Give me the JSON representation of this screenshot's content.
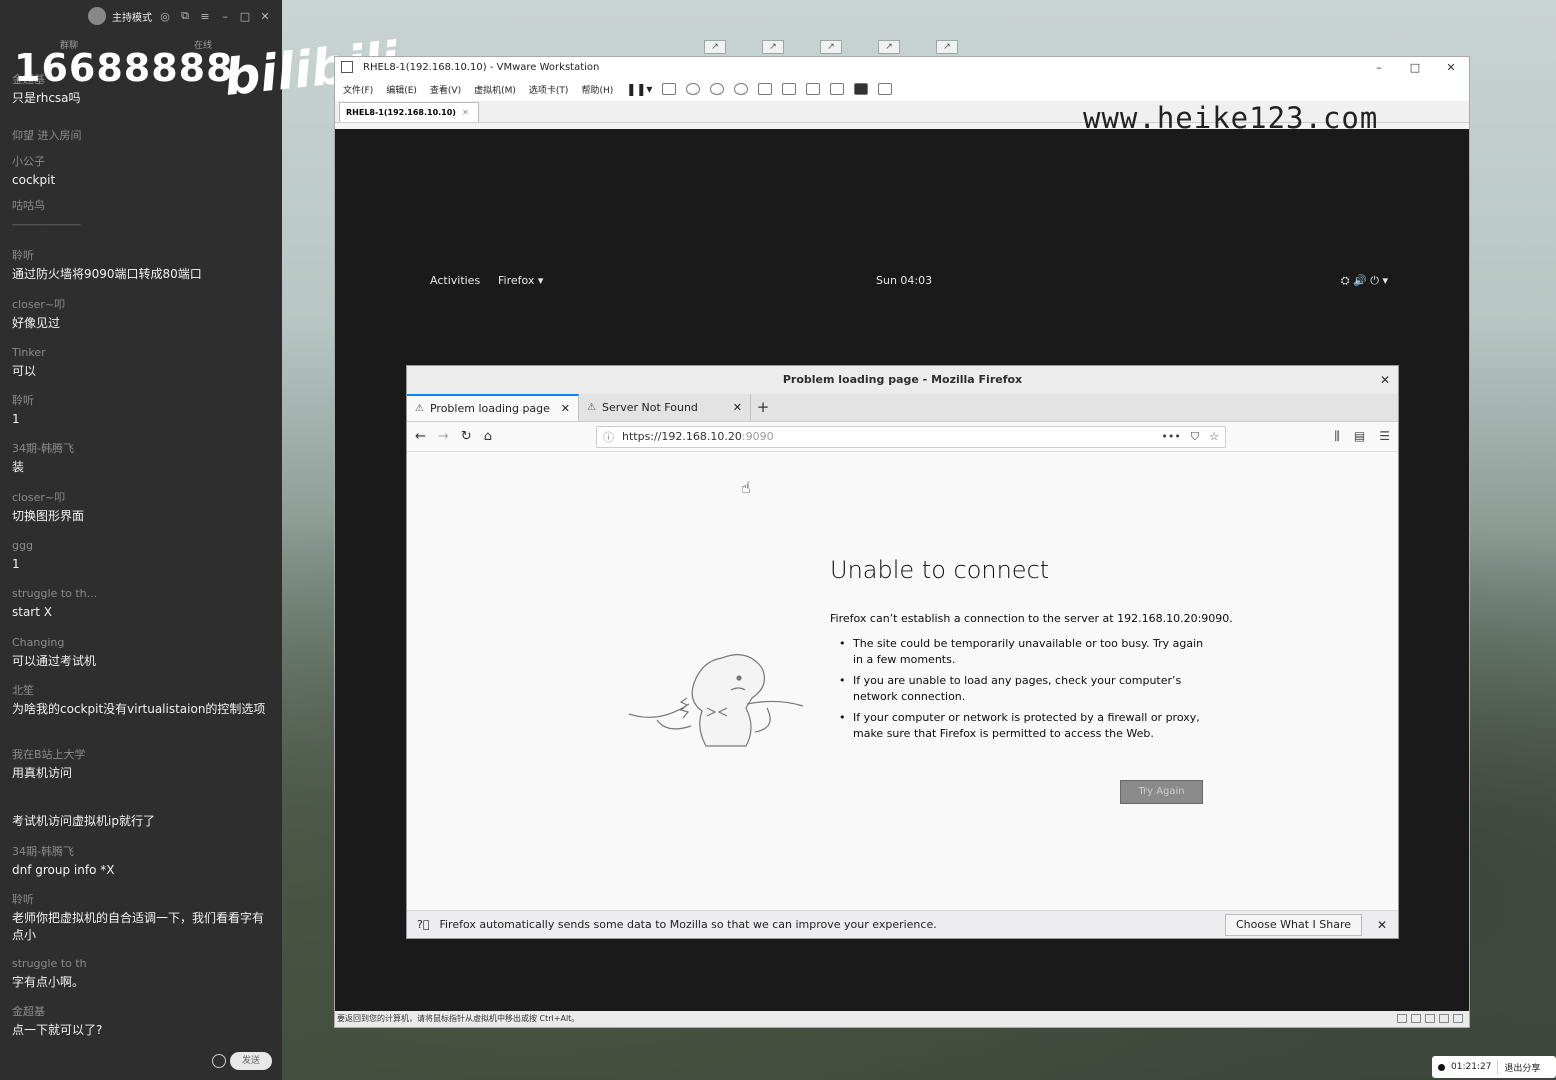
{
  "chat": {
    "mode_label": "主持模式",
    "subtabs": [
      "群聊",
      "在线"
    ],
    "counter": "16688888",
    "brand": "bilibili",
    "messages": [
      {
        "user": "金超基",
        "text": "只是rhcsa吗"
      },
      {
        "user": "",
        "text": "仰望 进入房间"
      },
      {
        "user": "小公子",
        "text": "cockpit"
      },
      {
        "user": "",
        "text": "咕咕鸟"
      },
      {
        "user": "",
        "text": "------------------------------------"
      },
      {
        "user": "聆听",
        "text": "通过防火墙将9090端口转成80端口"
      },
      {
        "user": "closer~叩",
        "text": "好像见过"
      },
      {
        "user": "Tinker",
        "text": "可以"
      },
      {
        "user": "聆听",
        "text": "1"
      },
      {
        "user": "34期-韩腾飞",
        "text": "装"
      },
      {
        "user": "closer~叩",
        "text": "切换图形界面"
      },
      {
        "user": "ggg",
        "text": "1"
      },
      {
        "user": "struggle to th...",
        "text": "start X"
      },
      {
        "user": "Changing",
        "text": "可以通过考试机"
      },
      {
        "user": "北笙 ",
        "text": "为啥我的cockpit没有virtualistaion的控制选项"
      },
      {
        "user": "我在B站上大学",
        "text": "用真机访问"
      },
      {
        "user": "",
        "text": "考试机访问虚拟机ip就行了"
      },
      {
        "user": "34期-韩腾飞",
        "text": "dnf group info  *X"
      },
      {
        "user": "聆听",
        "text": "老师你把虚拟机的自合适调一下，我们看看字有点小"
      },
      {
        "user": "struggle to th",
        "text": "字有点小啊。"
      },
      {
        "user": "金超基",
        "text": "点一下就可以了?"
      }
    ],
    "send_label": "发送"
  },
  "vmware": {
    "title": "RHEL8-1(192.168.10.10) - VMware Workstation",
    "menu": [
      "文件(F)",
      "编辑(E)",
      "查看(V)",
      "虚拟机(M)",
      "选项卡(T)",
      "帮助(H)"
    ],
    "tab_label": "RHEL8-1(192.168.10.10)",
    "watermark": "www.heike123.com",
    "status_text": "要返回到您的计算机，请将鼠标指针从虚拟机中移出或按 Ctrl+Alt。"
  },
  "gnome": {
    "activities": "Activities",
    "app_menu": "Firefox ▾",
    "clock": "Sun 04:03",
    "sys_icons": "⛭  🔊  ⏻ ▾"
  },
  "firefox": {
    "window_title": "Problem loading page - Mozilla Firefox",
    "tabs": [
      {
        "label": "Problem loading page",
        "active": true
      },
      {
        "label": "Server Not Found",
        "active": false
      }
    ],
    "url_host": "https://192.168.10.20",
    "url_port": ":9090",
    "error": {
      "title": "Unable to connect",
      "description": "Firefox can’t establish a connection to the server at 192.168.10.20:9090.",
      "bullets": [
        "The site could be temporarily unavailable or too busy. Try again in a few moments.",
        "If you are unable to load any pages, check your computer’s network connection.",
        "If your computer or network is protected by a firewall or proxy, make sure that Firefox is permitted to access the Web."
      ],
      "try_again": "Try Again"
    },
    "notification": {
      "text": "Firefox automatically sends some data to Mozilla so that we can improve your experience.",
      "button": "Choose What I Share"
    }
  },
  "tray": {
    "time": "01:21:27",
    "exit_label": "退出分享"
  }
}
